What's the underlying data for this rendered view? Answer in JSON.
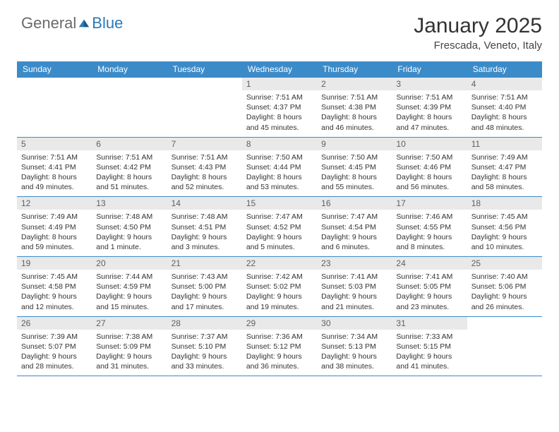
{
  "brand": {
    "part1": "General",
    "part2": "Blue"
  },
  "title": {
    "month": "January 2025",
    "location": "Frescada, Veneto, Italy"
  },
  "dayNames": [
    "Sunday",
    "Monday",
    "Tuesday",
    "Wednesday",
    "Thursday",
    "Friday",
    "Saturday"
  ],
  "weeks": [
    [
      null,
      null,
      null,
      {
        "date": "1",
        "sunrise": "7:51 AM",
        "sunset": "4:37 PM",
        "daylight": "8 hours and 45 minutes."
      },
      {
        "date": "2",
        "sunrise": "7:51 AM",
        "sunset": "4:38 PM",
        "daylight": "8 hours and 46 minutes."
      },
      {
        "date": "3",
        "sunrise": "7:51 AM",
        "sunset": "4:39 PM",
        "daylight": "8 hours and 47 minutes."
      },
      {
        "date": "4",
        "sunrise": "7:51 AM",
        "sunset": "4:40 PM",
        "daylight": "8 hours and 48 minutes."
      }
    ],
    [
      {
        "date": "5",
        "sunrise": "7:51 AM",
        "sunset": "4:41 PM",
        "daylight": "8 hours and 49 minutes."
      },
      {
        "date": "6",
        "sunrise": "7:51 AM",
        "sunset": "4:42 PM",
        "daylight": "8 hours and 51 minutes."
      },
      {
        "date": "7",
        "sunrise": "7:51 AM",
        "sunset": "4:43 PM",
        "daylight": "8 hours and 52 minutes."
      },
      {
        "date": "8",
        "sunrise": "7:50 AM",
        "sunset": "4:44 PM",
        "daylight": "8 hours and 53 minutes."
      },
      {
        "date": "9",
        "sunrise": "7:50 AM",
        "sunset": "4:45 PM",
        "daylight": "8 hours and 55 minutes."
      },
      {
        "date": "10",
        "sunrise": "7:50 AM",
        "sunset": "4:46 PM",
        "daylight": "8 hours and 56 minutes."
      },
      {
        "date": "11",
        "sunrise": "7:49 AM",
        "sunset": "4:47 PM",
        "daylight": "8 hours and 58 minutes."
      }
    ],
    [
      {
        "date": "12",
        "sunrise": "7:49 AM",
        "sunset": "4:49 PM",
        "daylight": "8 hours and 59 minutes."
      },
      {
        "date": "13",
        "sunrise": "7:48 AM",
        "sunset": "4:50 PM",
        "daylight": "9 hours and 1 minute."
      },
      {
        "date": "14",
        "sunrise": "7:48 AM",
        "sunset": "4:51 PM",
        "daylight": "9 hours and 3 minutes."
      },
      {
        "date": "15",
        "sunrise": "7:47 AM",
        "sunset": "4:52 PM",
        "daylight": "9 hours and 5 minutes."
      },
      {
        "date": "16",
        "sunrise": "7:47 AM",
        "sunset": "4:54 PM",
        "daylight": "9 hours and 6 minutes."
      },
      {
        "date": "17",
        "sunrise": "7:46 AM",
        "sunset": "4:55 PM",
        "daylight": "9 hours and 8 minutes."
      },
      {
        "date": "18",
        "sunrise": "7:45 AM",
        "sunset": "4:56 PM",
        "daylight": "9 hours and 10 minutes."
      }
    ],
    [
      {
        "date": "19",
        "sunrise": "7:45 AM",
        "sunset": "4:58 PM",
        "daylight": "9 hours and 12 minutes."
      },
      {
        "date": "20",
        "sunrise": "7:44 AM",
        "sunset": "4:59 PM",
        "daylight": "9 hours and 15 minutes."
      },
      {
        "date": "21",
        "sunrise": "7:43 AM",
        "sunset": "5:00 PM",
        "daylight": "9 hours and 17 minutes."
      },
      {
        "date": "22",
        "sunrise": "7:42 AM",
        "sunset": "5:02 PM",
        "daylight": "9 hours and 19 minutes."
      },
      {
        "date": "23",
        "sunrise": "7:41 AM",
        "sunset": "5:03 PM",
        "daylight": "9 hours and 21 minutes."
      },
      {
        "date": "24",
        "sunrise": "7:41 AM",
        "sunset": "5:05 PM",
        "daylight": "9 hours and 23 minutes."
      },
      {
        "date": "25",
        "sunrise": "7:40 AM",
        "sunset": "5:06 PM",
        "daylight": "9 hours and 26 minutes."
      }
    ],
    [
      {
        "date": "26",
        "sunrise": "7:39 AM",
        "sunset": "5:07 PM",
        "daylight": "9 hours and 28 minutes."
      },
      {
        "date": "27",
        "sunrise": "7:38 AM",
        "sunset": "5:09 PM",
        "daylight": "9 hours and 31 minutes."
      },
      {
        "date": "28",
        "sunrise": "7:37 AM",
        "sunset": "5:10 PM",
        "daylight": "9 hours and 33 minutes."
      },
      {
        "date": "29",
        "sunrise": "7:36 AM",
        "sunset": "5:12 PM",
        "daylight": "9 hours and 36 minutes."
      },
      {
        "date": "30",
        "sunrise": "7:34 AM",
        "sunset": "5:13 PM",
        "daylight": "9 hours and 38 minutes."
      },
      {
        "date": "31",
        "sunrise": "7:33 AM",
        "sunset": "5:15 PM",
        "daylight": "9 hours and 41 minutes."
      },
      null
    ]
  ],
  "labels": {
    "sunrise": "Sunrise: ",
    "sunset": "Sunset: ",
    "daylight": "Daylight: "
  }
}
